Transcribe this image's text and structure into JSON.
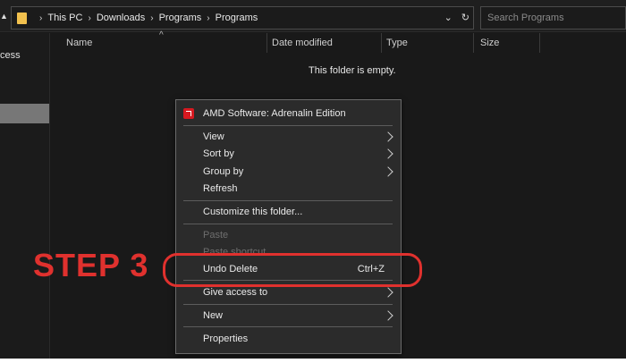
{
  "address_bar": {
    "breadcrumb": [
      "This PC",
      "Downloads",
      "Programs",
      "Programs"
    ],
    "dropdown_glyph": "⌄",
    "refresh_glyph": "↻"
  },
  "search": {
    "placeholder": "Search Programs"
  },
  "sidebar": {
    "quick_access_fragment": "cess"
  },
  "columns": [
    "Name",
    "Date modified",
    "Type",
    "Size"
  ],
  "empty_message": "This folder is empty.",
  "context_menu": {
    "header": {
      "label": "AMD Software: Adrenalin Edition",
      "icon": "amd-logo-icon"
    },
    "items": [
      {
        "label": "View",
        "submenu": true
      },
      {
        "label": "Sort by",
        "submenu": true
      },
      {
        "label": "Group by",
        "submenu": true
      },
      {
        "label": "Refresh"
      },
      {
        "label": "Customize this folder..."
      },
      {
        "label": "Paste",
        "disabled": true
      },
      {
        "label": "Paste shortcut",
        "disabled": true
      },
      {
        "label": "Undo Delete",
        "shortcut": "Ctrl+Z"
      },
      {
        "label": "Give access to",
        "submenu": true
      },
      {
        "label": "New",
        "submenu": true
      },
      {
        "label": "Properties"
      }
    ]
  },
  "annotation": {
    "text": "STEP 3",
    "color": "#e0312e"
  },
  "colors": {
    "folder": "#f2c14e",
    "amd_red": "#d71920",
    "background": "#191919",
    "menu_bg": "#2b2b2b"
  }
}
